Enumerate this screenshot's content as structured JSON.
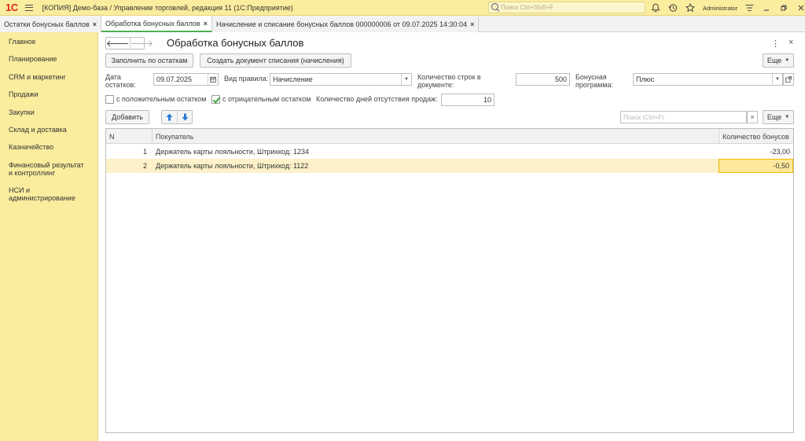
{
  "app": {
    "logo": "1С",
    "title": "[КОПИЯ] Демо-база / Управление торговлей, редакция 11  (1С:Предприятие)",
    "search_placeholder": "Поиск Ctrl+Shift+F",
    "user": "Administrator"
  },
  "tabs": [
    {
      "label": "Остатки бонусных баллов",
      "active": false
    },
    {
      "label": "Обработка бонусных баллов",
      "active": true
    },
    {
      "label": "Начисление и списание бонусных баллов 000000006 от 09.07.2025 14:30:04",
      "active": false
    }
  ],
  "sidebar": {
    "items": [
      {
        "label": "Главное"
      },
      {
        "label": "Планирование"
      },
      {
        "label": "CRM и маркетинг"
      },
      {
        "label": "Продажи"
      },
      {
        "label": "Закупки"
      },
      {
        "label": "Склад и доставка"
      },
      {
        "label": "Казначейство"
      },
      {
        "label": "Финансовый результат и контроллинг"
      },
      {
        "label": "НСИ и администрирование"
      }
    ]
  },
  "form": {
    "title": "Обработка бонусных баллов",
    "fill_button": "Заполнить по остаткам",
    "create_doc_button": "Создать документ списания (начисления)",
    "more_label": "Еще",
    "date_label": "Дата остатков:",
    "date_value": "09.07.2025",
    "rule_label": "Вид правила:",
    "rule_value": "Начисление",
    "rows_label": "Количество строк в документе:",
    "rows_value": "500",
    "program_label": "Бонусная программа:",
    "program_value": "Плюс",
    "positive_label": "с положительным остатком",
    "positive_checked": false,
    "negative_label": "с отрицательным остатком",
    "negative_checked": true,
    "days_label": "Количество дней отсутствия продаж:",
    "days_value": "10",
    "add_button": "Добавить",
    "search_placeholder": "Поиск (Ctrl+F)",
    "clear_symbol": "×"
  },
  "table": {
    "columns": {
      "n": "N",
      "buyer": "Покупатель",
      "bonus": "Количество бонусов"
    },
    "rows": [
      {
        "n": "1",
        "buyer": "Держатель карты лояльности, Штрихкод: 1234",
        "bonus": "-23,00"
      },
      {
        "n": "2",
        "buyer": "Держатель карты лояльности, Штрихкод: 1122",
        "bonus": "-0,50"
      }
    ]
  },
  "colors": {
    "panel": "#fbed9e",
    "active_tab_accent": "#4caf50",
    "selected_row": "#fcf1c8",
    "current_cell_border": "#f0b800",
    "logo_red": "#d52a1e"
  }
}
